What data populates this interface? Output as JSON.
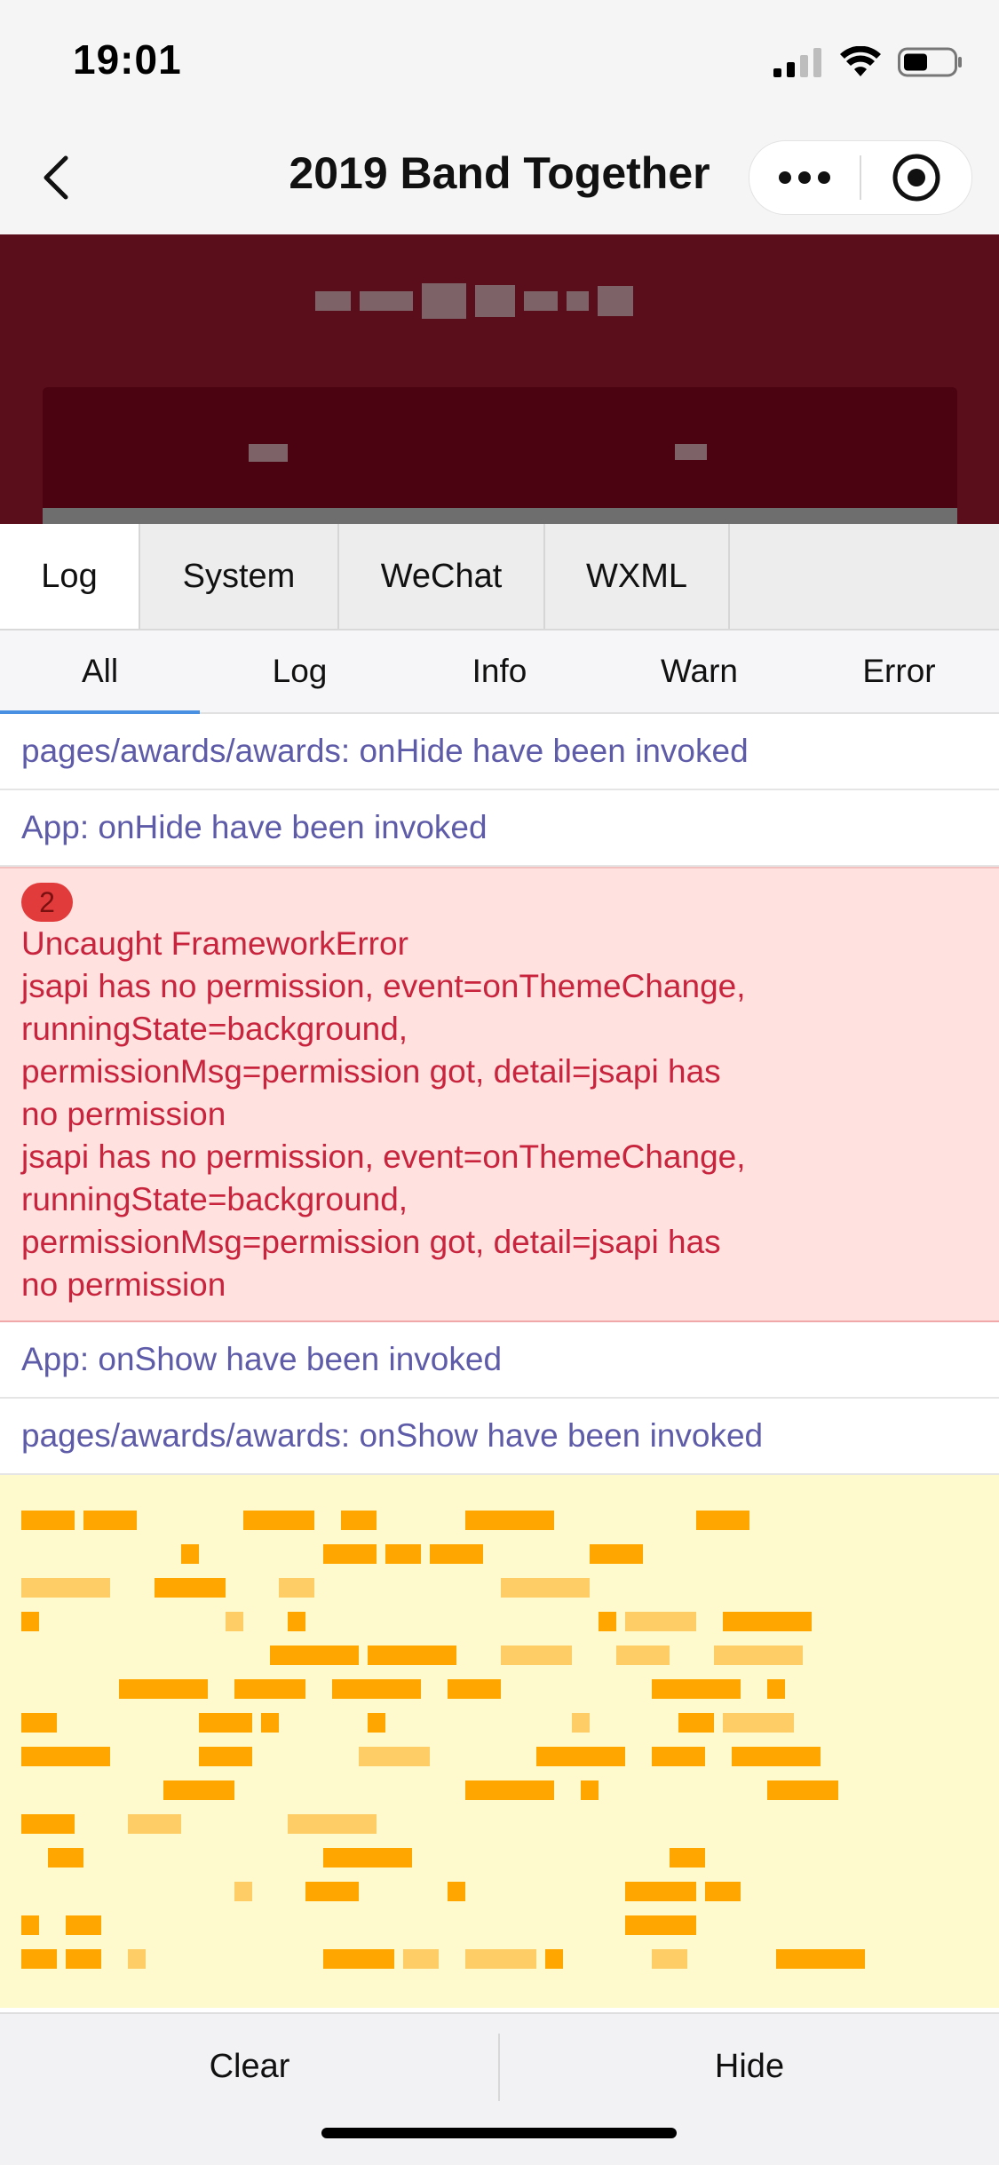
{
  "status_bar": {
    "time": "19:01"
  },
  "nav": {
    "title": "2019 Band Together"
  },
  "vconsole": {
    "tabs": [
      {
        "label": "Log",
        "active": true
      },
      {
        "label": "System",
        "active": false
      },
      {
        "label": "WeChat",
        "active": false
      },
      {
        "label": "WXML",
        "active": false
      }
    ],
    "filters": [
      {
        "label": "All",
        "active": true
      },
      {
        "label": "Log",
        "active": false
      },
      {
        "label": "Info",
        "active": false
      },
      {
        "label": "Warn",
        "active": false
      },
      {
        "label": "Error",
        "active": false
      }
    ],
    "logs": [
      {
        "level": "info",
        "text": "pages/awards/awards: onHide have been invoked"
      },
      {
        "level": "info",
        "text": "App: onHide have been invoked"
      },
      {
        "level": "error",
        "count": "2",
        "lines": [
          "Uncaught FrameworkError",
          "jsapi has no permission, event=onThemeChange,",
          "runningState=background,",
          "permissionMsg=permission got, detail=jsapi has",
          "no permission",
          "jsapi has no permission, event=onThemeChange,",
          "runningState=background,",
          "permissionMsg=permission got, detail=jsapi has",
          "no permission"
        ]
      },
      {
        "level": "info",
        "text": "App: onShow have been invoked"
      },
      {
        "level": "info",
        "text": "pages/awards/awards: onShow have been invoked"
      },
      {
        "level": "warn",
        "text": ""
      }
    ]
  },
  "bottom": {
    "clear_label": "Clear",
    "hide_label": "Hide"
  },
  "colors": {
    "banner": "#5a0e1c",
    "info_text": "#5e5ba8",
    "error_bg": "#ffe1df",
    "error_text": "#c8243d",
    "warn_bg": "#fffacd",
    "active_underline": "#4a90e2"
  }
}
